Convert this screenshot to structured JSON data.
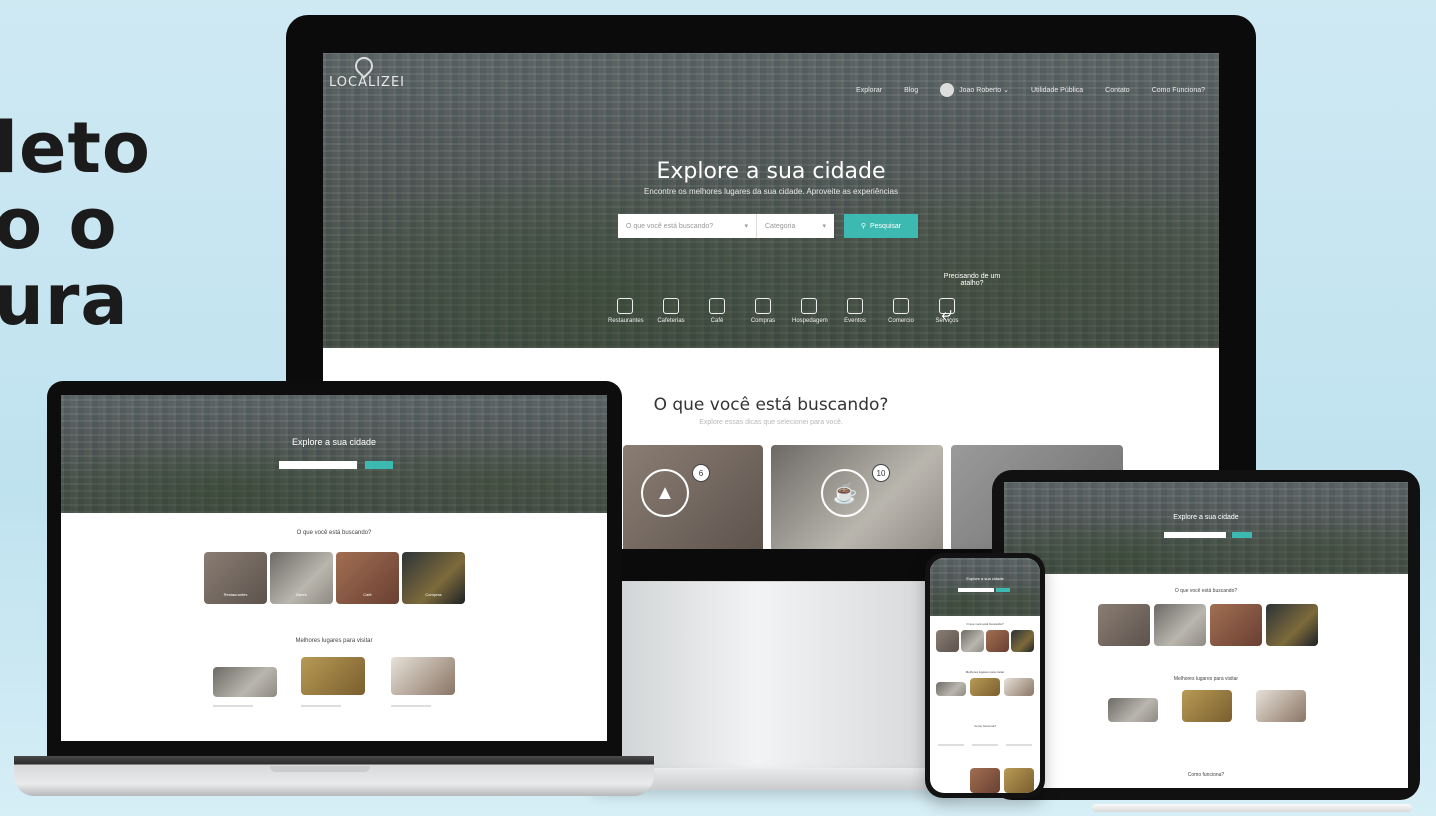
{
  "headline": {
    "line1": "leto",
    "line2": "o o",
    "line3": "ura"
  },
  "brand": {
    "logo_text": "LOCALIZEI",
    "accent_color": "#3cb9b0"
  },
  "nav": {
    "items": [
      "Explorar",
      "Blog",
      "Joao Roberto",
      "Utilidade Pública",
      "Contato",
      "Como Funciona?"
    ]
  },
  "hero": {
    "title": "Explore a sua cidade",
    "subtitle": "Encontre os melhores lugares da sua cidade. Aproveite as experiências",
    "search_placeholder": "O que você está buscando?",
    "category_placeholder": "Categoria",
    "search_button": "Pesquisar",
    "help_text": "Precisando de um atalho?"
  },
  "categories": [
    "Restaurantes",
    "Cafeterias",
    "Café",
    "Compras",
    "Hospedagem",
    "Eventos",
    "Comercio",
    "Serviços"
  ],
  "section_search": {
    "title": "O que você está buscando?",
    "subtitle": "Explore essas dicas que selecionei para você."
  },
  "tiles": [
    {
      "label": "Restaurantes",
      "count": "6",
      "icon": "pizza-icon"
    },
    {
      "label": "Café",
      "count": "10",
      "icon": "coffee-icon"
    }
  ],
  "small_tiles": [
    "Restaurantes",
    "Bares",
    "Café",
    "Compras"
  ],
  "section_best": {
    "title": "Melhores lugares para visitar"
  },
  "best_places": [
    "Itapetininga",
    "Rio",
    "Café Martins"
  ],
  "section_how": {
    "title": "Como funciona?"
  }
}
